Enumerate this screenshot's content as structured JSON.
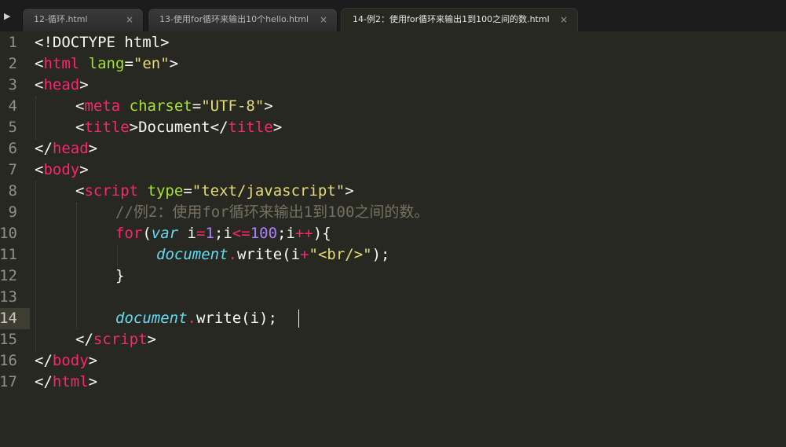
{
  "tabs": [
    {
      "label": "12-循环.html",
      "close": "×"
    },
    {
      "label": "13-使用for循环来输出10个hello.html",
      "close": "×"
    },
    {
      "label": "14-例2：使用for循环来输出1到100之间的数.html",
      "close": "×"
    }
  ],
  "sidebar_toggle": "▶",
  "line_numbers": [
    "1",
    "2",
    "3",
    "4",
    "5",
    "6",
    "7",
    "8",
    "9",
    "10",
    "11",
    "12",
    "13",
    "14",
    "15",
    "16",
    "17"
  ],
  "code": {
    "l1": [
      "<!DOCTYPE html>"
    ],
    "l2": [
      "<",
      "html",
      " ",
      "lang",
      "=",
      "\"en\"",
      ">"
    ],
    "l3": [
      "<",
      "head",
      ">"
    ],
    "l4": [
      "<",
      "meta",
      " ",
      "charset",
      "=",
      "\"UTF-8\"",
      ">"
    ],
    "l5": [
      "<",
      "title",
      ">",
      "Document",
      "</",
      "title",
      ">"
    ],
    "l6": [
      "</",
      "head",
      ">"
    ],
    "l7": [
      "<",
      "body",
      ">"
    ],
    "l8": [
      "<",
      "script",
      " ",
      "type",
      "=",
      "\"text/javascript\"",
      ">"
    ],
    "l9": [
      "//例2：使用for循环来输出1到100之间的数。"
    ],
    "l10": [
      "for",
      "(",
      "var",
      " i",
      "=",
      "1",
      ";i",
      "<=",
      "100",
      ";i",
      "++",
      "){"
    ],
    "l11": [
      "document",
      ".",
      "write",
      "(i",
      "+",
      "\"<br/>\"",
      ");"
    ],
    "l12": [
      "}"
    ],
    "l14": [
      "document",
      ".",
      "write",
      "(i);"
    ],
    "l15": [
      "</",
      "script",
      ">"
    ],
    "l16": [
      "</",
      "body",
      ">"
    ],
    "l17": [
      "</",
      "html",
      ">"
    ]
  },
  "colors": {
    "background": "#272822",
    "tag": "#f92672",
    "attribute": "#a6e22e",
    "string": "#e6db74",
    "number": "#ae81ff",
    "object": "#66d9ef",
    "comment": "#75715e",
    "text": "#f8f8f2"
  },
  "editor": {
    "current_line": "14"
  }
}
